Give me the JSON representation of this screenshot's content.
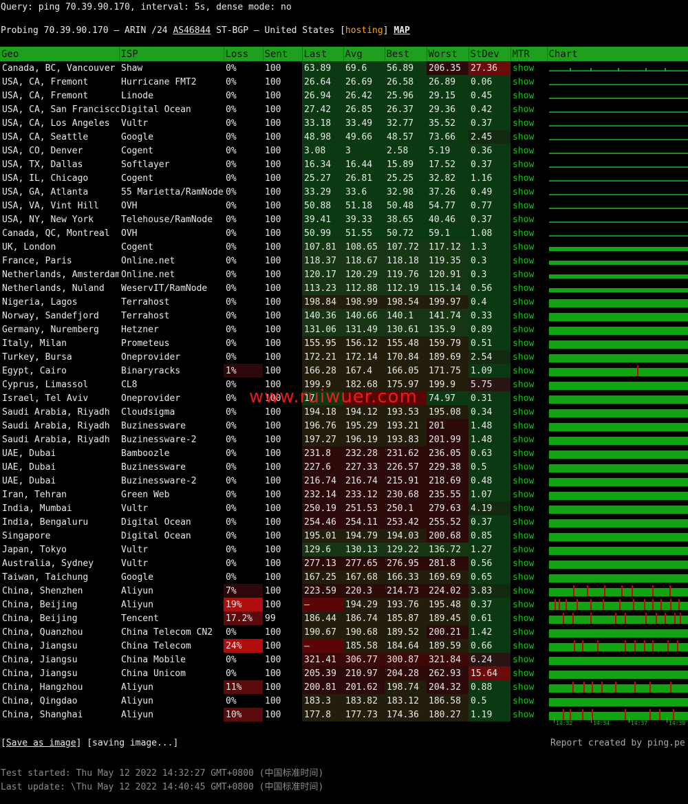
{
  "query": "Query: ping 70.39.90.170, interval: 5s, dense mode: no",
  "probe": {
    "prefix": "Probing 70.39.90.170 – ARIN /24 ",
    "asn": "AS46844",
    "middle": " ST-BGP – United States ",
    "hosting": "hosting",
    "map": "MAP"
  },
  "columns": [
    "Geo",
    "ISP",
    "Loss",
    "Sent",
    "Last",
    "Avg",
    "Best",
    "Worst",
    "StDev",
    "MTR",
    "Chart"
  ],
  "show_label": "show",
  "rows": [
    [
      "Canada, BC, Vancouver",
      "Shaw",
      "0%",
      "100",
      "63.89",
      "69.6",
      "56.89",
      "206.35",
      "27.36"
    ],
    [
      "USA, CA, Fremont",
      "Hurricane FMT2",
      "0%",
      "100",
      "26.64",
      "26.69",
      "26.58",
      "26.89",
      "0.06"
    ],
    [
      "USA, CA, Fremont",
      "Linode",
      "0%",
      "100",
      "26.94",
      "26.42",
      "25.96",
      "29.15",
      "0.45"
    ],
    [
      "USA, CA, San Francisco",
      "Digital Ocean",
      "0%",
      "100",
      "27.42",
      "26.85",
      "26.37",
      "29.36",
      "0.42"
    ],
    [
      "USA, CA, Los Angeles",
      "Vultr",
      "0%",
      "100",
      "33.18",
      "33.49",
      "32.77",
      "35.52",
      "0.37"
    ],
    [
      "USA, CA, Seattle",
      "Google",
      "0%",
      "100",
      "48.98",
      "49.66",
      "48.57",
      "73.66",
      "2.45"
    ],
    [
      "USA, CO, Denver",
      "Cogent",
      "0%",
      "100",
      "3.08",
      "3",
      "2.58",
      "5.19",
      "0.36"
    ],
    [
      "USA, TX, Dallas",
      "Softlayer",
      "0%",
      "100",
      "16.34",
      "16.44",
      "15.89",
      "17.52",
      "0.37"
    ],
    [
      "USA, IL, Chicago",
      "Cogent",
      "0%",
      "100",
      "25.27",
      "26.81",
      "25.25",
      "32.82",
      "1.16"
    ],
    [
      "USA, GA, Atlanta",
      "55 Marietta/RamNode",
      "0%",
      "100",
      "33.29",
      "33.6",
      "32.98",
      "37.26",
      "0.49"
    ],
    [
      "USA, VA, Vint Hill",
      "OVH",
      "0%",
      "100",
      "50.88",
      "51.18",
      "50.48",
      "54.77",
      "0.77"
    ],
    [
      "USA, NY, New York",
      "Telehouse/RamNode",
      "0%",
      "100",
      "39.41",
      "39.33",
      "38.65",
      "40.46",
      "0.37"
    ],
    [
      "Canada, QC, Montreal",
      "OVH",
      "0%",
      "100",
      "50.99",
      "51.55",
      "50.72",
      "59.1",
      "1.08"
    ],
    [
      "UK, London",
      "Cogent",
      "0%",
      "100",
      "107.81",
      "108.65",
      "107.72",
      "117.12",
      "1.3"
    ],
    [
      "France, Paris",
      "Online.net",
      "0%",
      "100",
      "118.37",
      "118.67",
      "118.18",
      "119.35",
      "0.3"
    ],
    [
      "Netherlands, Amsterdam",
      "Online.net",
      "0%",
      "100",
      "120.17",
      "120.29",
      "119.76",
      "120.91",
      "0.3"
    ],
    [
      "Netherlands, Nuland",
      "WeservIT/RamNode",
      "0%",
      "100",
      "113.23",
      "112.88",
      "112.19",
      "115.14",
      "0.56"
    ],
    [
      "Nigeria, Lagos",
      "Terrahost",
      "0%",
      "100",
      "198.84",
      "198.99",
      "198.54",
      "199.97",
      "0.4"
    ],
    [
      "Norway, Sandefjord",
      "Terrahost",
      "0%",
      "100",
      "140.36",
      "140.66",
      "140.1",
      "141.74",
      "0.33"
    ],
    [
      "Germany, Nuremberg",
      "Hetzner",
      "0%",
      "100",
      "131.06",
      "131.49",
      "130.61",
      "135.9",
      "0.89"
    ],
    [
      "Italy, Milan",
      "Prometeus",
      "0%",
      "100",
      "155.95",
      "156.12",
      "155.48",
      "159.79",
      "0.51"
    ],
    [
      "Turkey, Bursa",
      "Oneprovider",
      "0%",
      "100",
      "172.21",
      "172.14",
      "170.84",
      "189.69",
      "2.54"
    ],
    [
      "Egypt, Cairo",
      "Binaryracks",
      "1%",
      "100",
      "166.28",
      "167.4",
      "166.05",
      "171.75",
      "1.09"
    ],
    [
      "Cyprus, Limassol",
      "CL8",
      "0%",
      "100",
      "199.9",
      "182.68",
      "175.97",
      "199.9",
      "5.75"
    ],
    [
      "Israel, Tel Aviv",
      "Oneprovider",
      "0%",
      "100",
      "17",
      "",
      "",
      "74.97",
      "0.31"
    ],
    [
      "Saudi Arabia, Riyadh",
      "Cloudsigma",
      "0%",
      "100",
      "194.18",
      "194.12",
      "193.53",
      "195.08",
      "0.34"
    ],
    [
      "Saudi Arabia, Riyadh",
      "Buzinessware",
      "0%",
      "100",
      "196.76",
      "195.29",
      "193.21",
      "201",
      "1.48"
    ],
    [
      "Saudi Arabia, Riyadh",
      "Buzinessware-2",
      "0%",
      "100",
      "197.27",
      "196.19",
      "193.83",
      "201.99",
      "1.48"
    ],
    [
      "UAE, Dubai",
      "Bamboozle",
      "0%",
      "100",
      "231.8",
      "232.28",
      "231.62",
      "236.05",
      "0.63"
    ],
    [
      "UAE, Dubai",
      "Buzinessware",
      "0%",
      "100",
      "227.6",
      "227.33",
      "226.57",
      "229.38",
      "0.5"
    ],
    [
      "UAE, Dubai",
      "Buzinessware-2",
      "0%",
      "100",
      "216.74",
      "216.74",
      "215.91",
      "218.69",
      "0.48"
    ],
    [
      "Iran, Tehran",
      "Green Web",
      "0%",
      "100",
      "232.14",
      "233.12",
      "230.68",
      "235.55",
      "1.07"
    ],
    [
      "India, Mumbai",
      "Vultr",
      "0%",
      "100",
      "250.19",
      "251.53",
      "250.1",
      "279.63",
      "4.19"
    ],
    [
      "India, Bengaluru",
      "Digital Ocean",
      "0%",
      "100",
      "254.46",
      "254.11",
      "253.42",
      "255.52",
      "0.37"
    ],
    [
      "Singapore",
      "Digital Ocean",
      "0%",
      "100",
      "195.01",
      "194.79",
      "194.03",
      "200.68",
      "0.85"
    ],
    [
      "Japan, Tokyo",
      "Vultr",
      "0%",
      "100",
      "129.6",
      "130.13",
      "129.22",
      "136.72",
      "1.27"
    ],
    [
      "Australia, Sydney",
      "Vultr",
      "0%",
      "100",
      "277.13",
      "277.65",
      "276.95",
      "281.8",
      "0.56"
    ],
    [
      "Taiwan, Taichung",
      "Google",
      "0%",
      "100",
      "167.25",
      "167.68",
      "166.33",
      "169.69",
      "0.65"
    ],
    [
      "China, Shenzhen",
      "Aliyun",
      "7%",
      "100",
      "223.59",
      "220.3",
      "214.73",
      "224.02",
      "3.83"
    ],
    [
      "China, Beijing",
      "Aliyun",
      "19%",
      "100",
      "–",
      "194.29",
      "193.76",
      "195.48",
      "0.37"
    ],
    [
      "China, Beijing",
      "Tencent",
      "17.2%",
      "99",
      "186.44",
      "186.74",
      "185.87",
      "189.45",
      "0.61"
    ],
    [
      "China, Quanzhou",
      "China Telecom CN2",
      "0%",
      "100",
      "190.67",
      "190.68",
      "189.52",
      "200.21",
      "1.42"
    ],
    [
      "China, Jiangsu",
      "China Telecom",
      "24%",
      "100",
      "–",
      "185.58",
      "184.64",
      "189.59",
      "0.66"
    ],
    [
      "China, Jiangsu",
      "China Mobile",
      "0%",
      "100",
      "321.41",
      "306.77",
      "300.87",
      "321.84",
      "6.24"
    ],
    [
      "China, Jiangsu",
      "China Unicom",
      "0%",
      "100",
      "205.39",
      "210.97",
      "204.28",
      "262.93",
      "15.64"
    ],
    [
      "China, Hangzhou",
      "Aliyun",
      "11%",
      "100",
      "200.81",
      "201.62",
      "198.74",
      "204.32",
      "0.88"
    ],
    [
      "China, Qingdao",
      "Aliyun",
      "0%",
      "100",
      "183.3",
      "183.82",
      "183.12",
      "186.58",
      "0.5"
    ],
    [
      "China, Shanghai",
      "Aliyun",
      "10%",
      "100",
      "177.8",
      "177.73",
      "174.36",
      "180.27",
      "1.19"
    ]
  ],
  "time_axis": [
    "14:32",
    "14:34",
    "14:37",
    "14:39"
  ],
  "save": {
    "link": "Save as image",
    "status": "[saving image...]"
  },
  "credit": "Report created by ping.pe",
  "started": "Test started: Thu May 12 2022 14:32:27 GMT+0800 (中国标准时间)",
  "updated": "Last update: \\Thu May 12 2022 14:40:45 GMT+0800 (中国标准时间)",
  "watermark": "www.ruiwuer.com",
  "colors": {
    "header": "#1e9f1e",
    "show": "#1fbf1f",
    "loss": "#d40000",
    "hosting": "#ffa500"
  }
}
